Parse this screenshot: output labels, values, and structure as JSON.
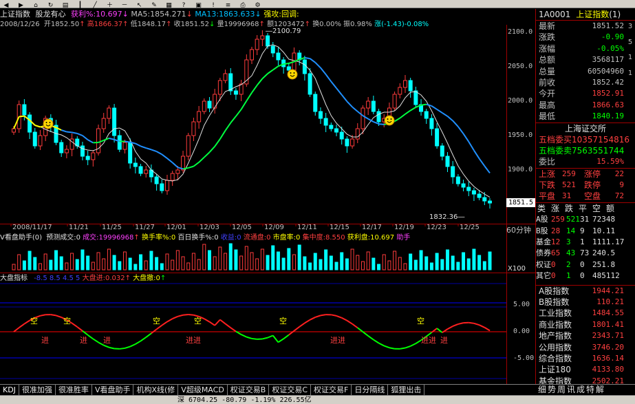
{
  "header": {
    "index_name": "上证指数",
    "indicator_name": "股龙有心",
    "winrate_label": "获利%:10.697",
    "ma5_label": "MA5:1854.271",
    "ma13_label": "MA13:1863.633",
    "strong_attack": "强攻:回调:",
    "date": "2008/12/26",
    "open": "开1852.50",
    "high": "高1866.37",
    "low": "低1848.17",
    "close": "收1851.52",
    "volume": "量19996968",
    "amount": "额1203472",
    "turnover": "换0.00%",
    "amplitude": "振0.98%",
    "change": "涨(-1.43)-0.08%"
  },
  "main_chart": {
    "y_ticks": [
      "2100.0",
      "2050.0",
      "2000.0",
      "1950.0",
      "1900.0"
    ],
    "high_annotation": "2100.79",
    "low_annotation": "1832.36",
    "last_price_tag": "1851.5",
    "period_label": "60分钟"
  },
  "date_axis": [
    "2008/11/17",
    "11/21",
    "11/25",
    "11/27",
    "12/01",
    "12/03",
    "12/05",
    "12/09",
    "12/11",
    "12/15",
    "12/17",
    "12/19",
    "12/23",
    "12/25"
  ],
  "volume_panel": {
    "title": "V看盘助手(0)",
    "forecast": "预测成交:0",
    "deal": "成交:19996968",
    "turnover_rate": "换手率%:0",
    "hundred_day_turnover": "百日换手%:0",
    "inflow": "收益:0",
    "outflow": "流通盘:0",
    "market_rate": "市盘率:0",
    "concentration": "集中度:8.550",
    "profit_plate": "获利盘:10.697",
    "helper": "助手",
    "scale_label": "X100"
  },
  "dp_panel": {
    "title": "大盘指标",
    "params": "-8.5 8.5 4.5 5",
    "in_value": "大盘进:0.032",
    "out_value": "大盘撤:0",
    "y_ticks": [
      "5.00",
      "0.00",
      "-5.00"
    ],
    "marks_kong": "空",
    "marks_jin": "进",
    "marks_jinjin": "进进"
  },
  "right_panel": {
    "code": "1A0001",
    "name": "上证指数",
    "tag": "(1)",
    "quotes": [
      {
        "label": "最新",
        "value": "1851.52",
        "color": "#c0c0c0"
      },
      {
        "label": "涨跌",
        "value": "-0.90",
        "color": "#00ff00"
      },
      {
        "label": "涨幅",
        "value": "-0.05%",
        "color": "#00ff00"
      },
      {
        "label": "总额",
        "value": "3568117",
        "color": "#c0c0c0"
      },
      {
        "label": "总量",
        "value": "60504960",
        "color": "#c0c0c0"
      },
      {
        "label": "前收",
        "value": "1852.42",
        "color": "#c0c0c0"
      },
      {
        "label": "今开",
        "value": "1852.91",
        "color": "#ff4040"
      },
      {
        "label": "最高",
        "value": "1866.63",
        "color": "#ff4040"
      },
      {
        "label": "最低",
        "value": "1840.19",
        "color": "#00ff00"
      }
    ],
    "exchange": "上海证交所",
    "bid_five": "五档委买10357154816",
    "ask_five": "五档委卖7563551744",
    "ratio_label": "委比",
    "ratio_value": "15.59%",
    "stats": [
      {
        "a": "上涨",
        "b": "259",
        "c": "涨停",
        "d": "22"
      },
      {
        "a": "下跌",
        "b": "521",
        "c": "跌停",
        "d": "9"
      },
      {
        "a": "平盘",
        "b": "31",
        "c": "空盘",
        "d": "72"
      }
    ],
    "table_header": [
      "类",
      "涨",
      "跌",
      "平",
      "空",
      "额"
    ],
    "table_rows": [
      [
        "A股",
        "259",
        "521",
        "31",
        "72348"
      ],
      [
        "B股",
        "28",
        "14",
        "9",
        "10.11"
      ],
      [
        "基金",
        "12",
        "3",
        "1",
        "1111.17"
      ],
      [
        "债券",
        "65",
        "43",
        "73",
        "240.5"
      ],
      [
        "权证",
        "0",
        "2",
        "0",
        "251.8"
      ],
      [
        "其它",
        "0",
        "1",
        "0",
        "485112"
      ]
    ],
    "indices": [
      {
        "name": "A股指数",
        "value": "1944.21"
      },
      {
        "name": "B股指数",
        "value": "110.21"
      },
      {
        "name": "工业指数",
        "value": "1484.55"
      },
      {
        "name": "商业指数",
        "value": "1801.41"
      },
      {
        "name": "地产指数",
        "value": "2343.71"
      },
      {
        "name": "公用指数",
        "value": "3746.20"
      },
      {
        "name": "综合指数",
        "value": "1636.14"
      },
      {
        "name": "上证180",
        "value": "4133.80"
      },
      {
        "name": "基金指数",
        "value": "2502.21"
      }
    ],
    "bottom_tabs": "细势周讯成特解"
  },
  "tabs": [
    "KDJ",
    "很准加强",
    "很准胜率",
    "V看盘助手",
    "机构X线(修",
    "V超级MACD",
    "权证交易B",
    "权证交易C",
    "权证交易F",
    "日分隔线",
    "狐狸出击"
  ],
  "status": "深 6704.25 -80.79 -1.19% 226.55亿"
}
